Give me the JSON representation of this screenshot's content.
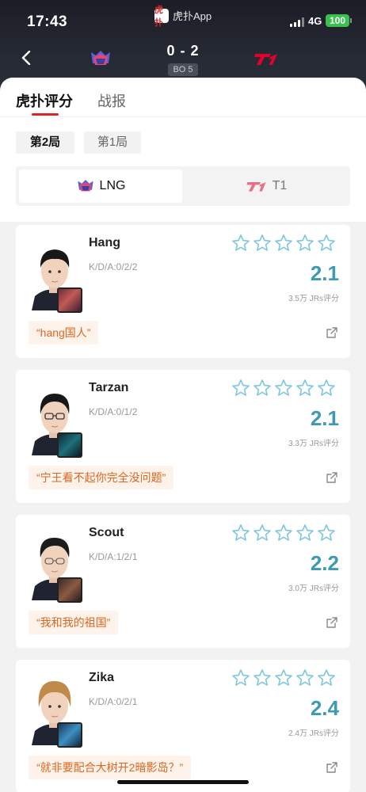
{
  "status_bar": {
    "time": "17:43",
    "app_name": "虎扑App",
    "app_logo_text": "虎扑",
    "network": "4G",
    "battery": "100",
    "battery_color": "#39c24f"
  },
  "match": {
    "score": "0 - 2",
    "format": "BO 5",
    "home_team": "LNG",
    "away_team": "T1"
  },
  "tabs": [
    {
      "label": "虎扑评分",
      "active": true
    },
    {
      "label": "战报",
      "active": false
    }
  ],
  "games": [
    {
      "label": "第2局",
      "active": true
    },
    {
      "label": "第1局",
      "active": false
    }
  ],
  "teams": [
    {
      "label": "LNG",
      "active": true
    },
    {
      "label": "T1",
      "active": false
    }
  ],
  "accent_color": "#d8262b",
  "rating_color": "#3d9ab2",
  "players": [
    {
      "name": "Hang",
      "kda": "K/D/A:0/2/2",
      "rating": "2.1",
      "votes": "3.5万 JRs评分",
      "quote": "“hang国人”",
      "champion_icon": "thresh-icon"
    },
    {
      "name": "Tarzan",
      "kda": "K/D/A:0/1/2",
      "rating": "2.1",
      "votes": "3.3万 JRs评分",
      "quote": "“宁王看不起你完全没问题”",
      "champion_icon": "viego-icon"
    },
    {
      "name": "Scout",
      "kda": "K/D/A:1/2/1",
      "rating": "2.2",
      "votes": "3.0万 JRs评分",
      "quote": "“我和我的祖国”",
      "champion_icon": "sylas-icon"
    },
    {
      "name": "Zika",
      "kda": "K/D/A:0/2/1",
      "rating": "2.4",
      "votes": "2.4万 JRs评分",
      "quote": "“就非要配合大树开2暗影岛？”",
      "champion_icon": "gwen-icon"
    }
  ]
}
